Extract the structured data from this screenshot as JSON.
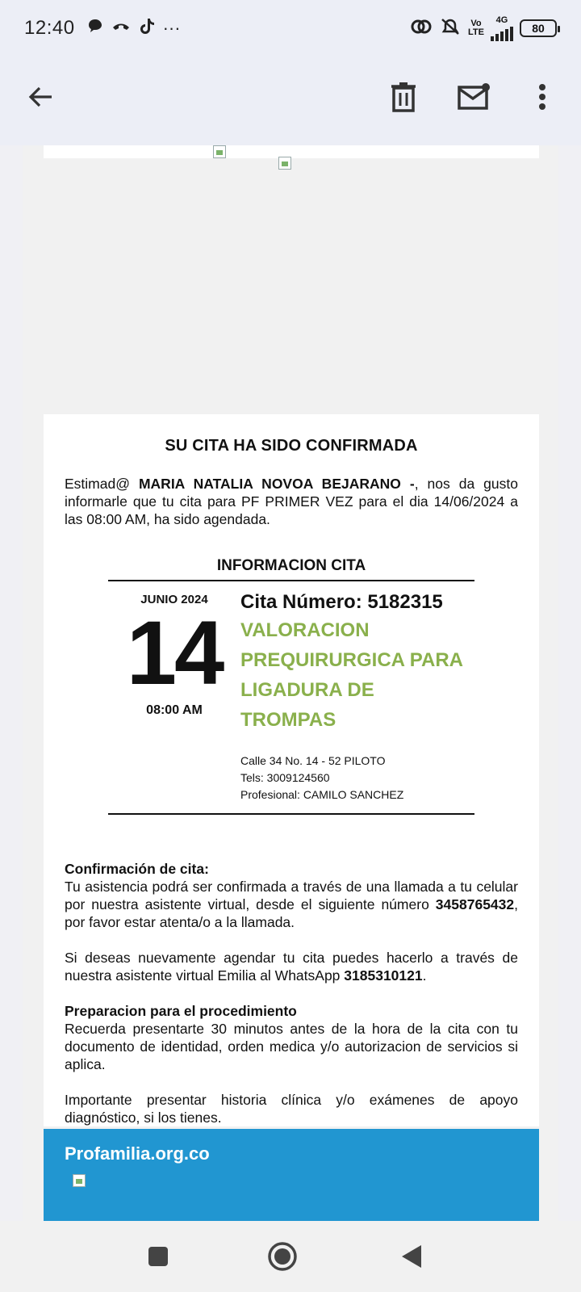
{
  "status_bar": {
    "time": "12:40",
    "dots": "···",
    "lte_top": "Vo",
    "lte_bottom": "LTE",
    "network": "4G",
    "battery": "80"
  },
  "email": {
    "confirm_title": "SU CITA HA SIDO CONFIRMADA",
    "intro_prefix": "Estimad@ ",
    "patient_name": "MARIA NATALIA NOVOA BEJARANO -",
    "intro_suffix": ", nos da gusto informarle que tu cita para PF PRIMER VEZ para el dia 14/06/2024 a las 08:00 AM, ha sido agendada.",
    "info_title": "INFORMACION CITA",
    "month_year": "JUNIO 2024",
    "day": "14",
    "time": "08:00 AM",
    "cita_number": "Cita Número: 5182315",
    "service": "VALORACION PREQUIRURGICA PARA LIGADURA DE TROMPAS",
    "address": "Calle 34 No. 14 - 52 PILOTO",
    "phones": "Tels: 3009124560",
    "professional": "Profesional: CAMILO SANCHEZ",
    "confirm_head": "Confirmación de cita:",
    "confirm_text": "Tu asistencia podrá ser confirmada a través de una llamada a tu celular por nuestra asistente virtual, desde el siguiente número ",
    "confirm_number": "3458765432",
    "confirm_text_end": ", por favor estar atenta/o a la llamada.",
    "reschedule_text": "Si deseas nuevamente agendar tu cita puedes hacerlo a través de nuestra asistente virtual Emilia al WhatsApp ",
    "whatsapp_number": "3185310121",
    "reschedule_end": ".",
    "prep_head": "Preparacion para el procedimiento",
    "prep_text": "Recuerda presentarte 30 minutos antes de la hora de la cita con tu documento de identidad, orden medica y/o autorizacion de servicios si aplica.",
    "important_text": "Importante presentar historia clínica y/o exámenes de apoyo diagnóstico, si los tienes.",
    "footer_link": "Profamilia.org.co"
  },
  "colors": {
    "service_green": "#8ab04c",
    "footer_blue": "#2196d1"
  },
  "icons": {
    "back": "back-arrow-icon",
    "delete": "trash-icon",
    "mark_unread": "mail-unread-icon",
    "more": "more-vert-icon"
  }
}
